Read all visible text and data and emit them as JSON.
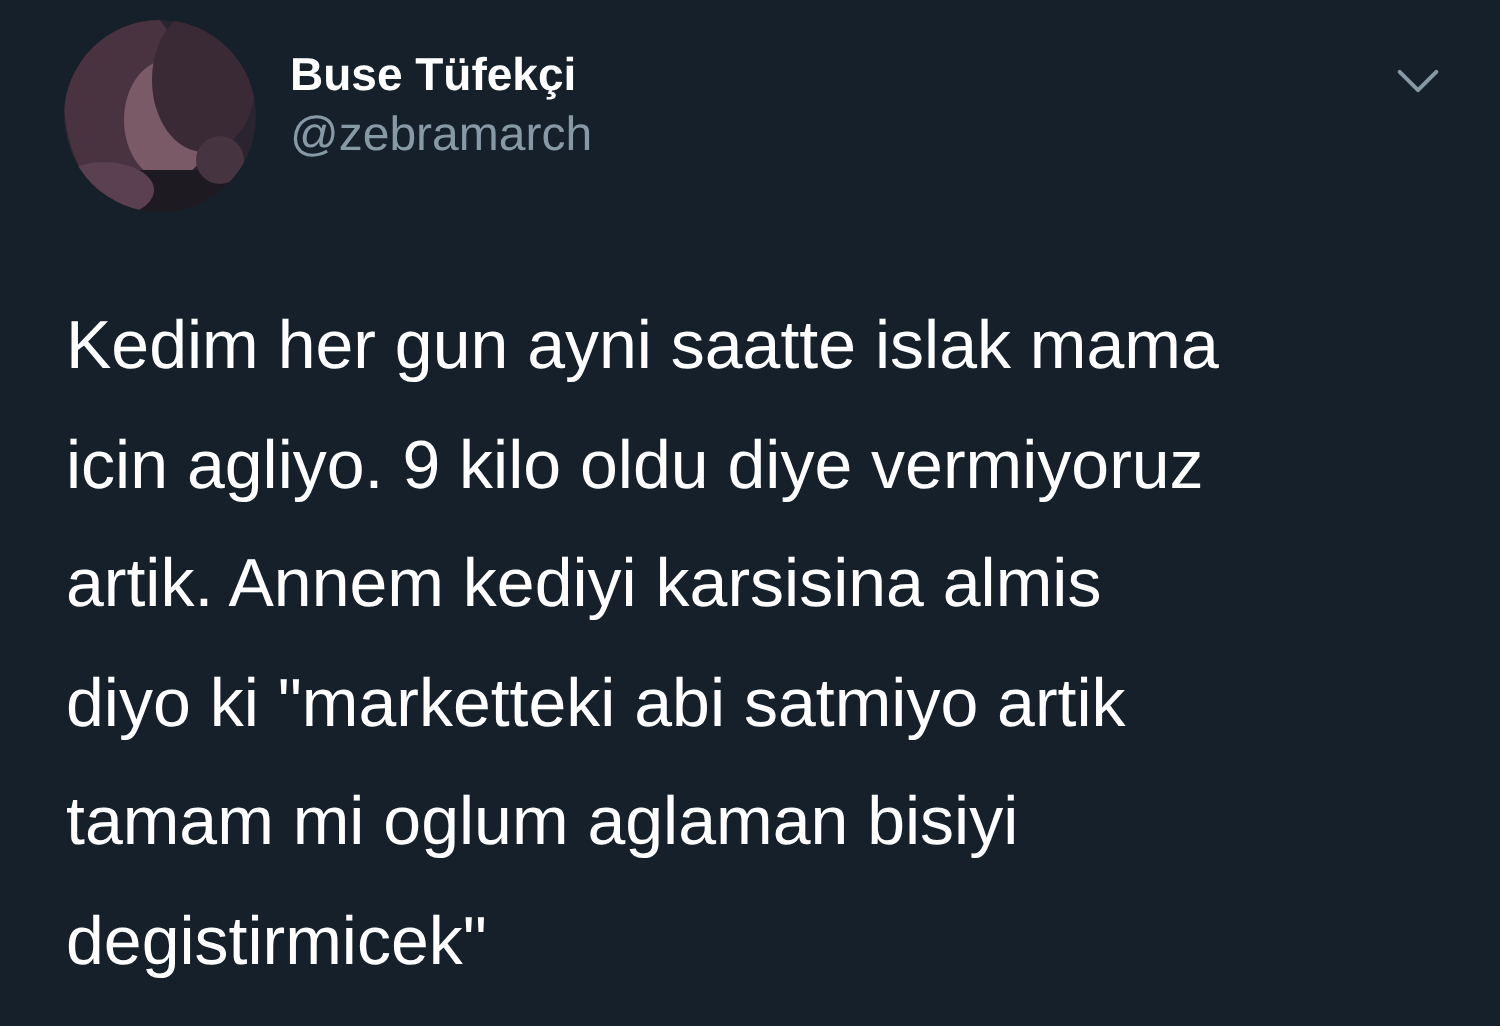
{
  "author": {
    "name": "Buse Tüfekçi",
    "handle": "@zebramarch"
  },
  "tweet": {
    "text": "Kedim her gun ayni saatte islak mama\nicin agliyo. 9 kilo oldu diye vermiyoruz\nartik. Annem kediyi karsisina almis\ndiyo ki \"marketteki abi satmiyo artik\ntamam mi oglum aglaman bisiyi\ndegistirmicek\""
  }
}
